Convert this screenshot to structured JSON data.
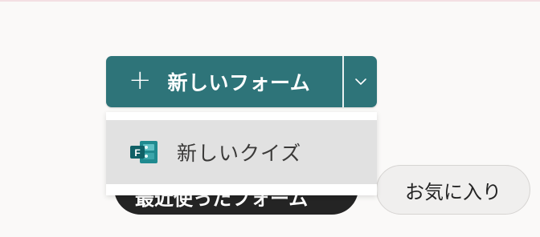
{
  "toolbar": {
    "new_form_label": "新しいフォーム",
    "plus_glyph": "+",
    "accent_color": "#2e7479"
  },
  "dropdown": {
    "items": [
      {
        "label": "新しいクイズ",
        "icon": "forms-quiz-icon"
      }
    ]
  },
  "filters": {
    "recent_label": "最近使ったフォーム",
    "favorites_label": "お気に入り"
  }
}
